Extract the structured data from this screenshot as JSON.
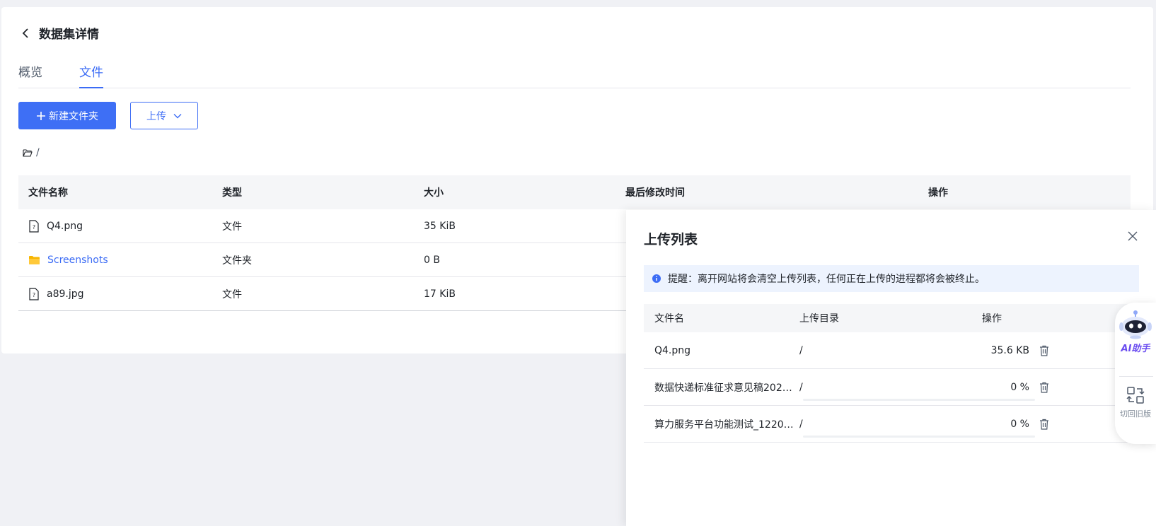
{
  "header": {
    "title": "数据集详情"
  },
  "tabs": [
    {
      "label": "概览"
    },
    {
      "label": "文件"
    }
  ],
  "toolbar": {
    "new_folder_label": "新建文件夹",
    "upload_label": "上传"
  },
  "breadcrumb": {
    "path": "/"
  },
  "file_table": {
    "columns": [
      "文件名称",
      "类型",
      "大小",
      "最后修改时间",
      "操作"
    ],
    "rows": [
      {
        "name": "Q4.png",
        "type": "文件",
        "size": "35 KiB",
        "icon": "file-icon"
      },
      {
        "name": "Screenshots",
        "type": "文件夹",
        "size": "0 B",
        "icon": "folder-icon"
      },
      {
        "name": "a89.jpg",
        "type": "文件",
        "size": "17 KiB",
        "icon": "file-icon"
      }
    ]
  },
  "upload_drawer": {
    "title": "上传列表",
    "notice": "提醒：离开网站将会清空上传列表，任何正在上传的进程都将会被终止。",
    "columns": [
      "文件名",
      "上传目录",
      "操作"
    ],
    "rows": [
      {
        "name": "Q4.png",
        "dir": "/",
        "status": "35.6 KB"
      },
      {
        "name": "数据快递标准征求意见稿2024…",
        "dir": "/",
        "status": "0 %",
        "progress": 0
      },
      {
        "name": "算力服务平台功能测试_1220.…",
        "dir": "/",
        "status": "0 %",
        "progress": 0
      }
    ]
  },
  "float_panel": {
    "ai_label": "AI助手",
    "switch_label": "切回旧版"
  },
  "colors": {
    "accent": "#3c6cf5",
    "folder": "#f7b500",
    "ai": "#6a4cf0"
  }
}
